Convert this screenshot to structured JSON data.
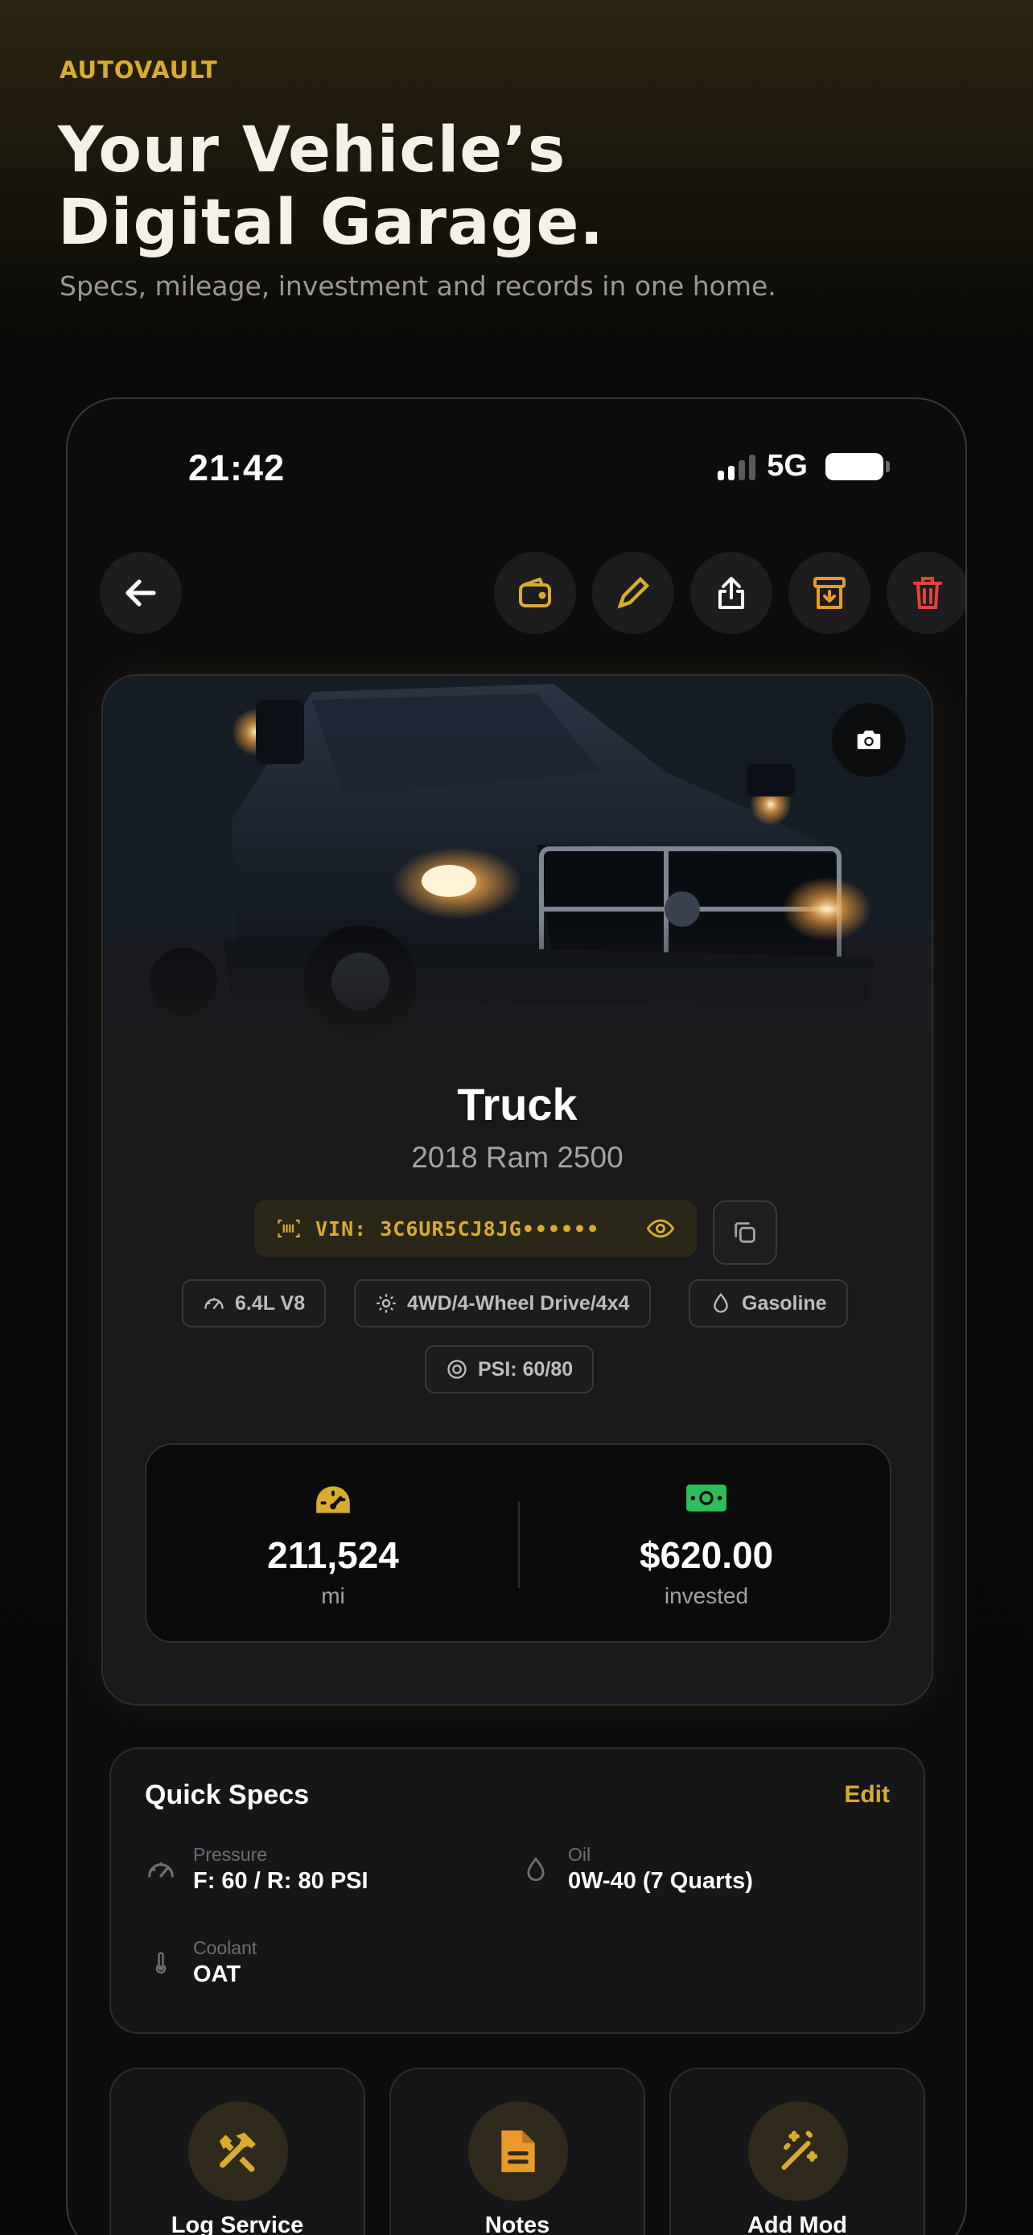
{
  "brand": "AUTOVAULT",
  "headline_line1": "Your Vehicle’s",
  "headline_line2": "Digital Garage.",
  "subline": "Specs, mileage, investment and records in one home.",
  "status": {
    "time": "21:42",
    "network": "5G"
  },
  "toolbar": {
    "back": "back-arrow-icon",
    "actions": [
      "wallet-icon",
      "pencil-icon",
      "share-icon",
      "archive-icon",
      "trash-icon"
    ]
  },
  "vehicle": {
    "name": "Truck",
    "model": "2018 Ram 2500",
    "vin": "VIN: 3C6UR5CJ8JG••••••",
    "chips": {
      "engine": "6.4L V8",
      "drive": "4WD/4-Wheel Drive/4x4",
      "fuel": "Gasoline",
      "psi": "PSI: 60/80"
    },
    "mileage": "211,524",
    "mileage_unit": "mi",
    "invested": "$620.00",
    "invested_label": "invested"
  },
  "quick_specs": {
    "title": "Quick Specs",
    "edit": "Edit",
    "pressure_label": "Pressure",
    "pressure_value": "F: 60 / R: 80 PSI",
    "oil_label": "Oil",
    "oil_value": "0W-40 (7 Quarts)",
    "coolant_label": "Coolant",
    "coolant_value": "OAT"
  },
  "actions": {
    "log_service": "Log Service",
    "notes": "Notes",
    "add_mod": "Add Mod"
  },
  "colors": {
    "accent": "#d9ac2f",
    "danger": "#e0453a",
    "money": "#2fbf5a",
    "background": "#0d0d0e"
  }
}
